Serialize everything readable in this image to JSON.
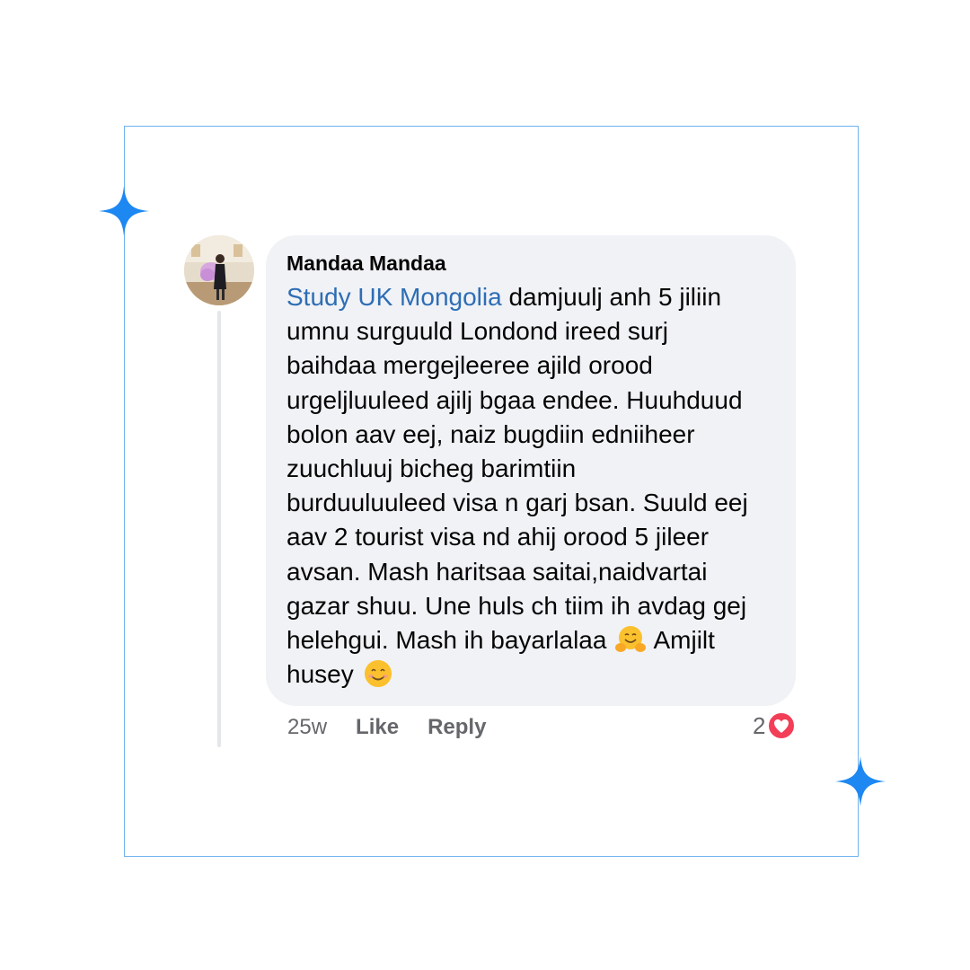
{
  "comment": {
    "author": "Mandaa Mandaa",
    "mention": "Study UK Mongolia",
    "text_lines": [
      " damjuulj anh 5 jiliin",
      "umnu surguuld Londond ireed surj",
      "baihdaa mergejleeree ajild orood",
      "urgeljluuleed ajilj bgaa endee. Huuhduud",
      "bolon aav eej, naiz bugdiin edniiheer",
      "zuuchluuj bicheg barimtiin",
      "burduuluuleed visa n garj bsan. Suuld eej",
      "aav 2 tourist visa nd ahij orood 5 jileer",
      "avsan. Mash haritsaa saitai,naidvartai",
      "gazar shuu. Une huls ch tiim ih avdag gej",
      "helehgui. Mash ih bayarlalaa",
      " Amjilt",
      "husey"
    ],
    "emojis": [
      "hugging-face",
      "smiling-face"
    ],
    "time": "25w",
    "like_label": "Like",
    "reply_label": "Reply",
    "reaction_count": "2",
    "reaction_type": "love"
  },
  "colors": {
    "frame": "#6fb3ef",
    "sparkle": "#1d88f2",
    "bubble": "#f0f2f5",
    "mention": "#2d6db5",
    "heart": "#f33e58"
  },
  "icons": {
    "sparkle": "four-point-star-icon",
    "reaction": "heart-icon"
  }
}
